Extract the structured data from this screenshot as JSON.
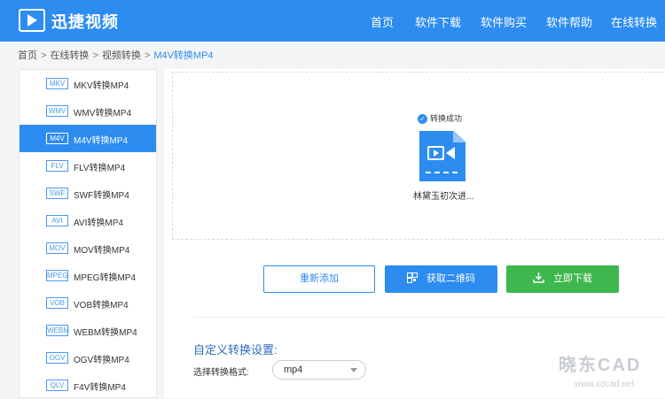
{
  "header": {
    "app_title": "迅捷视频",
    "nav": [
      "首页",
      "软件下载",
      "软件购买",
      "软件帮助",
      "在线转换"
    ]
  },
  "breadcrumb": {
    "items": [
      "首页",
      "在线转换",
      "视频转换"
    ],
    "current": "M4V转换MP4",
    "separator": ">"
  },
  "sidebar": {
    "active_index": 2,
    "items": [
      {
        "badge": "MKV",
        "label": "MKV转换MP4"
      },
      {
        "badge": "WMV",
        "label": "WMV转换MP4"
      },
      {
        "badge": "M4V",
        "label": "M4V转换MP4"
      },
      {
        "badge": "FLV",
        "label": "FLV转换MP4"
      },
      {
        "badge": "SWF",
        "label": "SWF转换MP4"
      },
      {
        "badge": "AVI",
        "label": "AVI转换MP4"
      },
      {
        "badge": "MOV",
        "label": "MOV转换MP4"
      },
      {
        "badge": "MPEG",
        "label": "MPEG转换MP4"
      },
      {
        "badge": "VOB",
        "label": "VOB转换MP4"
      },
      {
        "badge": "WEBM",
        "label": "WEBM转换MP4"
      },
      {
        "badge": "OGV",
        "label": "OGV转换MP4"
      },
      {
        "badge": "QLV",
        "label": "F4V转换MP4"
      }
    ]
  },
  "result": {
    "status": "转换成功",
    "file_icon": "video-file-icon",
    "file_name": "林黛玉初次进..."
  },
  "actions": {
    "readd": "重新添加",
    "qrcode": "获取二维码",
    "download": "立即下载"
  },
  "settings": {
    "title": "自定义转换设置:",
    "format_label": "选择转换格式:",
    "format_value": "mp4"
  },
  "watermark": {
    "text": "晓东CAD",
    "url": "www.xdcad.net"
  },
  "colors": {
    "primary": "#2d8cf0",
    "download_green": "#3fb74f"
  }
}
